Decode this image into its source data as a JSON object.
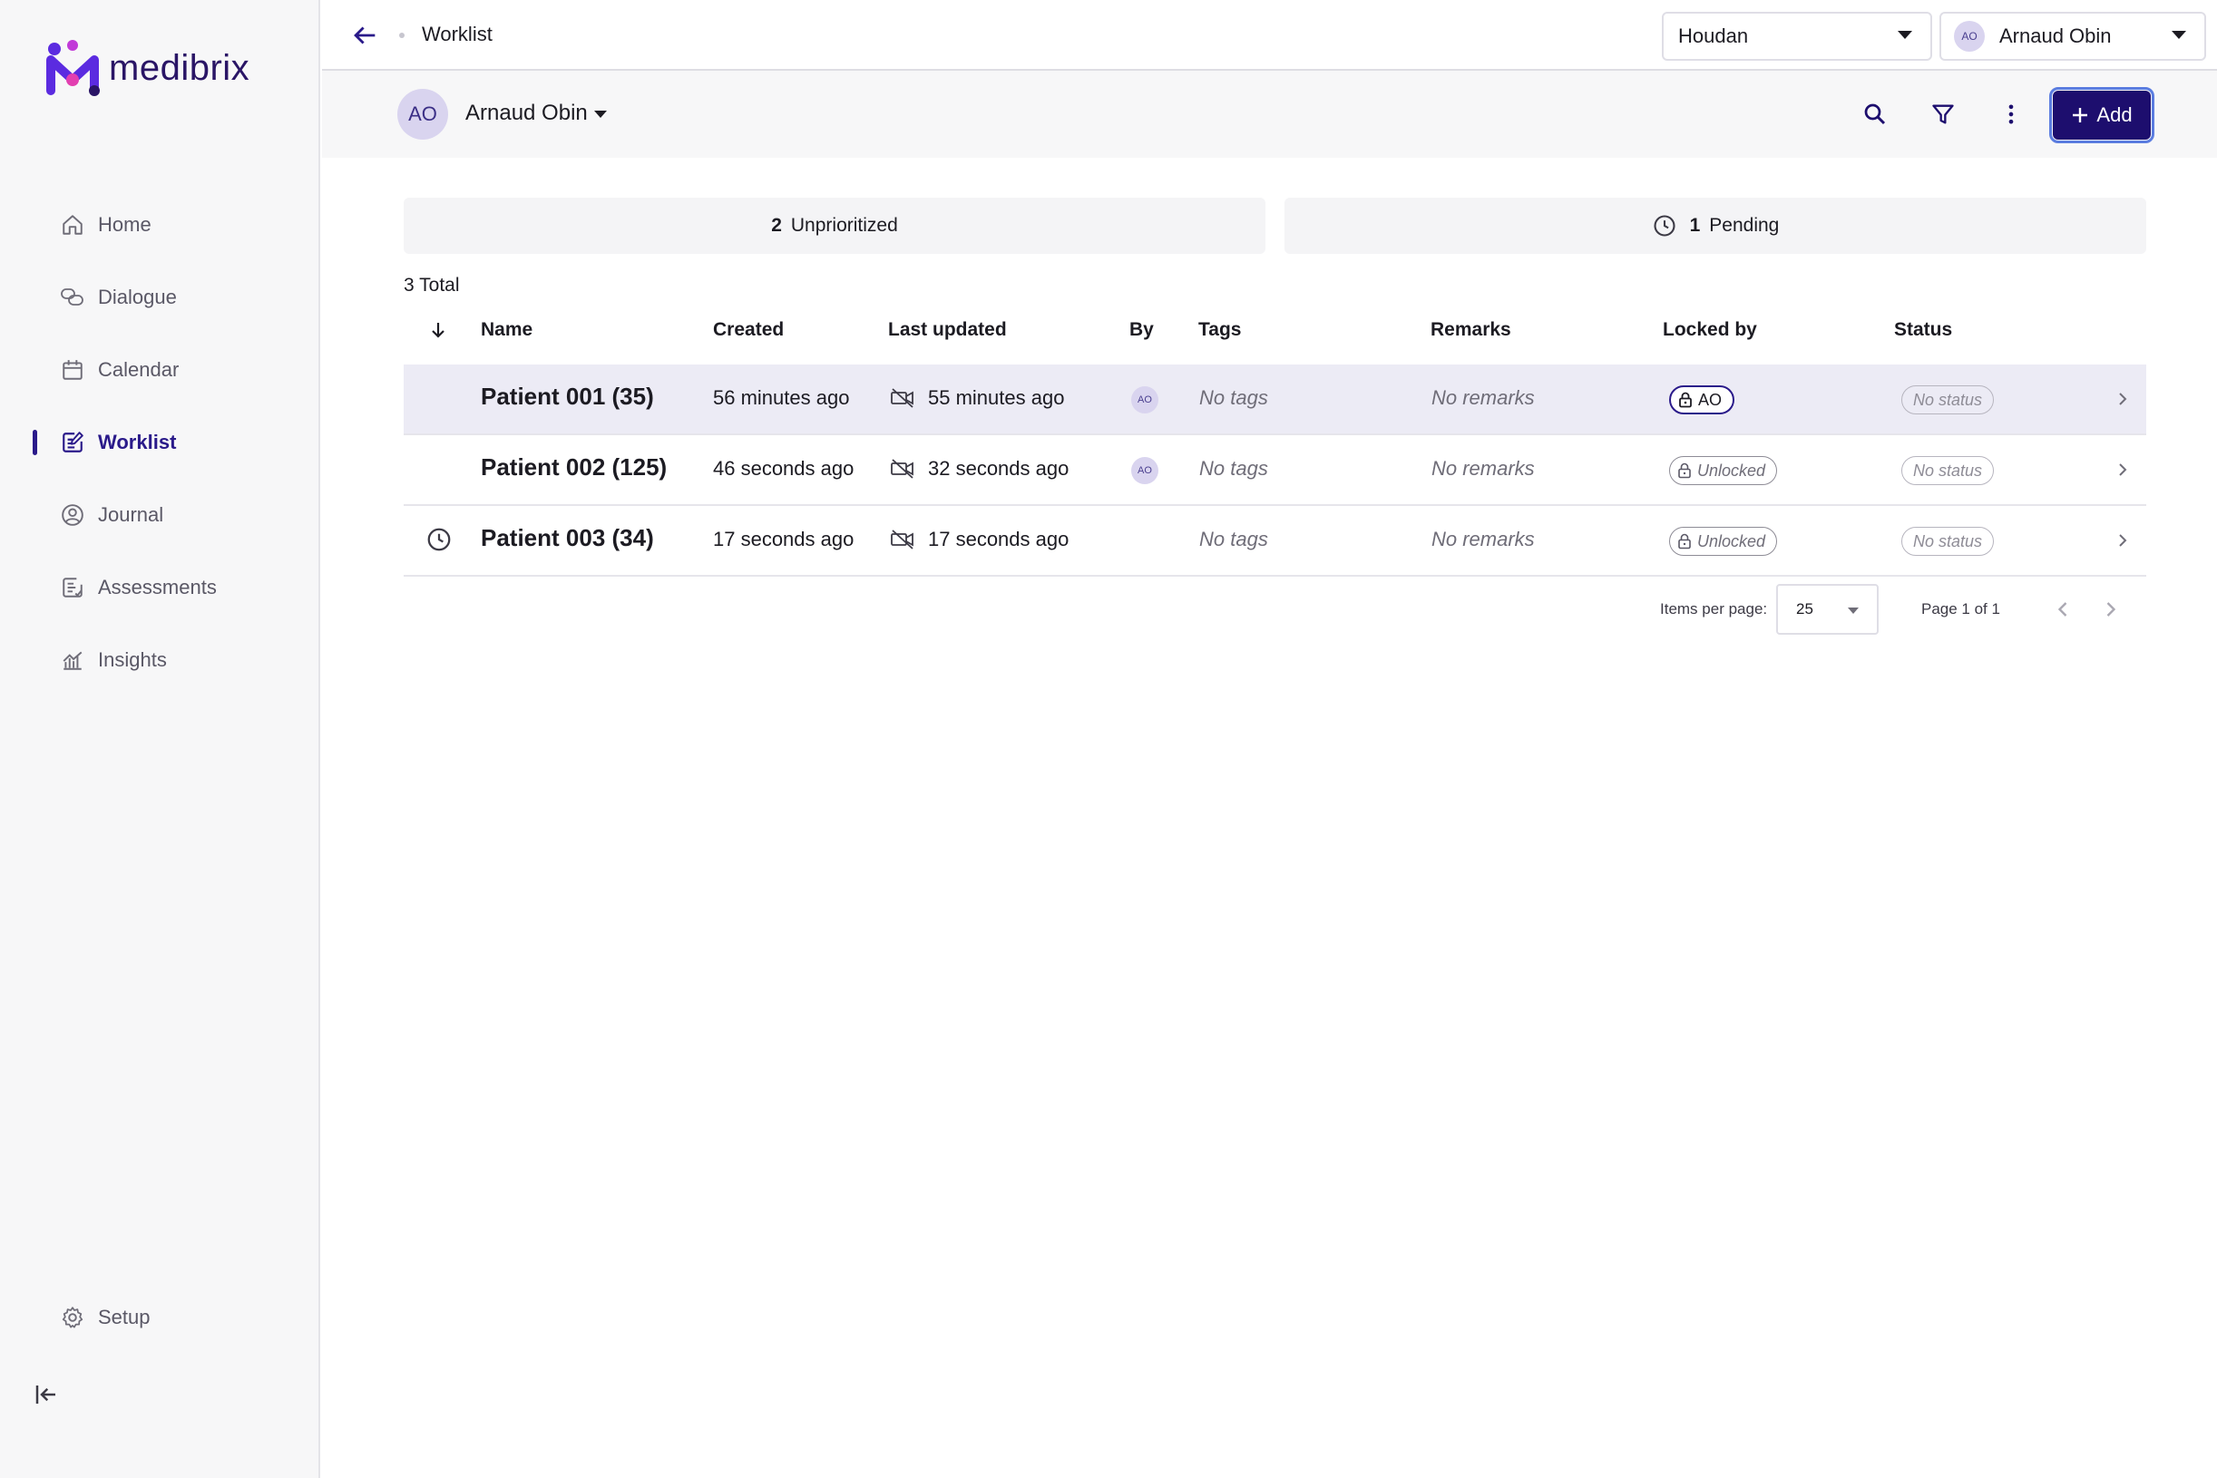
{
  "brand": {
    "name": "medibrix",
    "colors": {
      "primary": "#1d0e6e",
      "accent": "#c13ad8",
      "focus": "#5b7de0"
    }
  },
  "sidebar": {
    "items": [
      {
        "label": "Home",
        "icon": "home-icon"
      },
      {
        "label": "Dialogue",
        "icon": "dialogue-icon"
      },
      {
        "label": "Calendar",
        "icon": "calendar-icon"
      },
      {
        "label": "Worklist",
        "icon": "worklist-icon",
        "active": true
      },
      {
        "label": "Journal",
        "icon": "journal-icon"
      },
      {
        "label": "Assessments",
        "icon": "assessments-icon"
      },
      {
        "label": "Insights",
        "icon": "insights-icon"
      }
    ],
    "setup_label": "Setup"
  },
  "topbar": {
    "breadcrumb": "Worklist",
    "site": "Houdan",
    "user_initials": "AO",
    "user_name": "Arnaud Obin"
  },
  "subheader": {
    "owner_initials": "AO",
    "owner_name": "Arnaud Obin",
    "add_label": "Add"
  },
  "summary": {
    "unprioritized": {
      "count": "2",
      "label": "Unprioritized"
    },
    "pending": {
      "count": "1",
      "label": "Pending"
    }
  },
  "total_label": "3 Total",
  "table": {
    "headers": {
      "name": "Name",
      "created": "Created",
      "updated": "Last updated",
      "by": "By",
      "tags": "Tags",
      "remarks": "Remarks",
      "locked": "Locked by",
      "status": "Status"
    },
    "rows": [
      {
        "name": "Patient 001 (35)",
        "created": "56 minutes ago",
        "updated": "55 minutes ago",
        "by": "AO",
        "tags": "No tags",
        "remarks": "No remarks",
        "locked": "AO",
        "status": "No status"
      },
      {
        "name": "Patient 002 (125)",
        "created": "46 seconds ago",
        "updated": "32 seconds ago",
        "by": "AO",
        "tags": "No tags",
        "remarks": "No remarks",
        "locked": "Unlocked",
        "status": "No status"
      },
      {
        "name": "Patient 003 (34)",
        "created": "17 seconds ago",
        "updated": "17 seconds ago",
        "by": "",
        "tags": "No tags",
        "remarks": "No remarks",
        "locked": "Unlocked",
        "status": "No status"
      }
    ]
  },
  "pagination": {
    "items_per_page_label": "Items per page:",
    "items_per_page": "25",
    "page_info": "Page 1 of 1"
  }
}
